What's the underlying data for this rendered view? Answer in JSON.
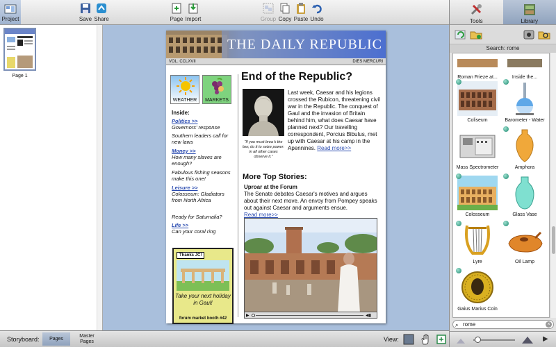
{
  "toolbar": {
    "project": "Project",
    "save": "Save",
    "share": "Share",
    "page": "Page",
    "import": "Import",
    "group": "Group",
    "copy": "Copy",
    "paste": "Paste",
    "undo": "Undo"
  },
  "right_panel": {
    "tabs": {
      "tools": "Tools",
      "library": "Library"
    },
    "search_label": "Search: rome",
    "search_value": "rome",
    "items": [
      {
        "label": "Roman Frieze at...",
        "icon": "frieze-icon"
      },
      {
        "label": "Inside the...",
        "icon": "interior-icon"
      },
      {
        "label": "Coliseum",
        "icon": "coliseum-photo-icon"
      },
      {
        "label": "Barometer - Water",
        "icon": "barometer-icon"
      },
      {
        "label": "Mass Spectrometer",
        "icon": "spectrometer-icon"
      },
      {
        "label": "Amphora",
        "icon": "amphora-icon"
      },
      {
        "label": "Colosseum",
        "icon": "colosseum-icon"
      },
      {
        "label": "Glass Vase",
        "icon": "vase-icon"
      },
      {
        "label": "Lyre",
        "icon": "lyre-icon"
      },
      {
        "label": "Oil Lamp",
        "icon": "oil-lamp-icon"
      },
      {
        "label": "Gaius Marius Coin",
        "icon": "coin-icon"
      }
    ]
  },
  "storyboard": {
    "page_label": "Page 1",
    "label": "Storyboard:",
    "tab_pages": "Pages",
    "tab_master_1": "Master",
    "tab_master_2": "Pages",
    "view_label": "View:"
  },
  "newspaper": {
    "title": "THE DAILY REPUBLIC",
    "volume": "VOL. CCLXVII",
    "date": "DIES MERCURI",
    "weather": "WEATHER",
    "markets": "MARKETS",
    "inside_heading": "Inside:",
    "index": [
      {
        "link": "Politics >>",
        "text": "Governors' response"
      },
      {
        "link": "",
        "text": "Southern leaders call for new laws"
      },
      {
        "link": "Money >>",
        "text": "How many slaves are enough?"
      },
      {
        "link": "",
        "text": "Fabulous fishing seasons make this one!"
      },
      {
        "link": "Leisure >>",
        "text": "Colosseum: Gladiators from North Africa"
      },
      {
        "link": "",
        "text": "Ready for Saturnalia?"
      },
      {
        "link": "Life >>",
        "text": "Can your coral ring"
      }
    ],
    "ad": {
      "thanks": "Thanks JC!",
      "text": "Take your next holiday in Gaul!",
      "footer": "forum market booth #42"
    },
    "headline": "End of the Republic?",
    "bust_caption": "\"If you must brea k the law, do it to seize power: in all other cases observe it.\"",
    "story1": "Last week, Caesar and his legions crossed the Rubicon, threatening civil war in the Republic. The conquest of Gaul and the invasion of Britain behind him, what does Caesar have planned next? Our travelling correspondent, Porcius Bibulus, met up with Caesar at his camp in the Apennines.",
    "read_more_1": "Read more>>",
    "more_heading": "More Top Stories:",
    "uproar_heading": "Uproar at the Forum",
    "story2": "The Senate debates Caesar's motives and argues about their next move. An envoy from Pompey speaks out against Caesar and arguments ensue.",
    "read_more_2": "Read more>>"
  }
}
